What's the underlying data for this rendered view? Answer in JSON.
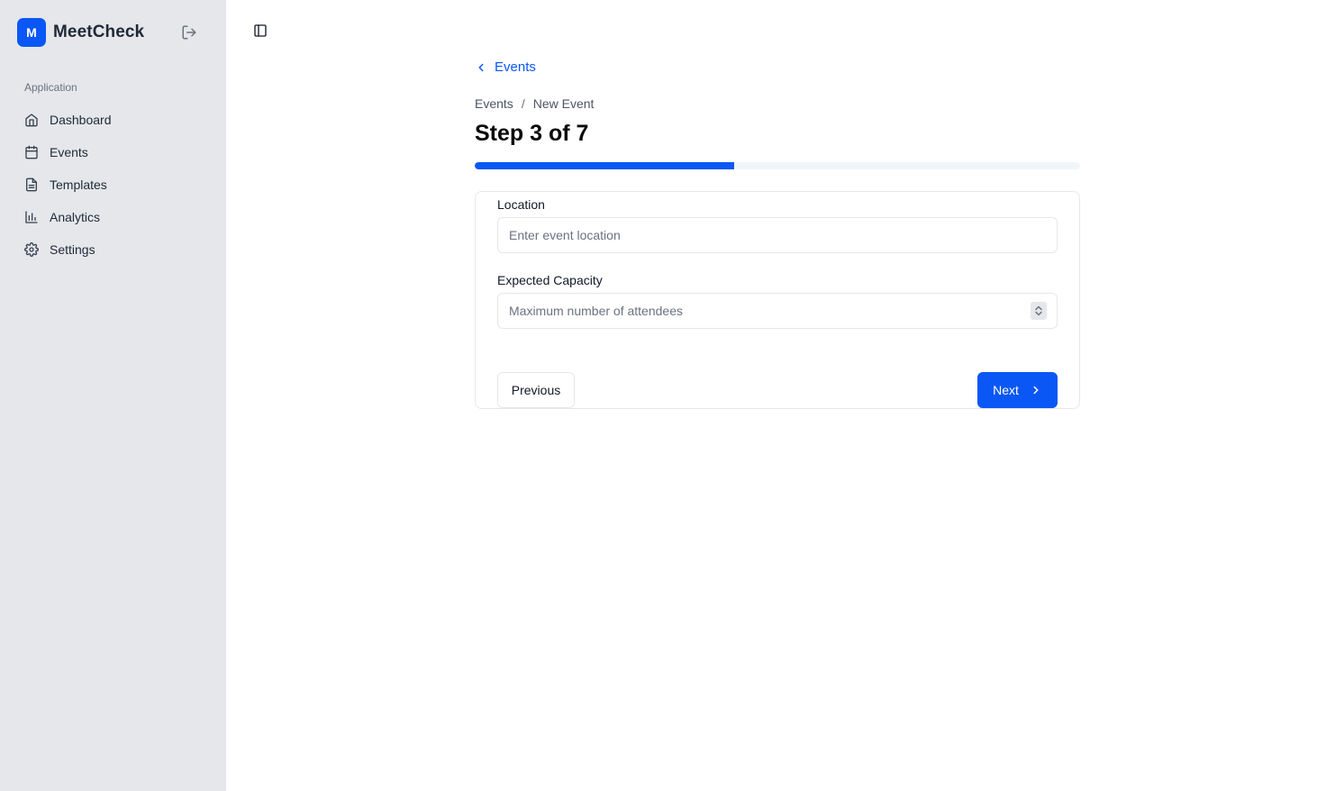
{
  "app": {
    "logo_letter": "M",
    "name": "MeetCheck"
  },
  "sidebar": {
    "section_label": "Application",
    "items": [
      {
        "label": "Dashboard",
        "icon": "home-icon"
      },
      {
        "label": "Events",
        "icon": "calendar-icon"
      },
      {
        "label": "Templates",
        "icon": "file-text-icon"
      },
      {
        "label": "Analytics",
        "icon": "bar-chart-icon"
      },
      {
        "label": "Settings",
        "icon": "gear-icon"
      }
    ]
  },
  "header": {
    "back_label": "Events",
    "breadcrumb": [
      "Events",
      "New Event"
    ],
    "breadcrumb_separator": "/",
    "title": "Step 3 of 7",
    "progress_fraction": 0.4286
  },
  "form": {
    "location": {
      "label": "Location",
      "placeholder": "Enter event location",
      "value": ""
    },
    "capacity": {
      "label": "Expected Capacity",
      "placeholder": "Maximum number of attendees",
      "value": ""
    },
    "previous_label": "Previous",
    "next_label": "Next"
  },
  "colors": {
    "accent": "#0b57f5",
    "sidebar_bg": "#e5e7eb",
    "progress_track": "#f1f5f9"
  }
}
